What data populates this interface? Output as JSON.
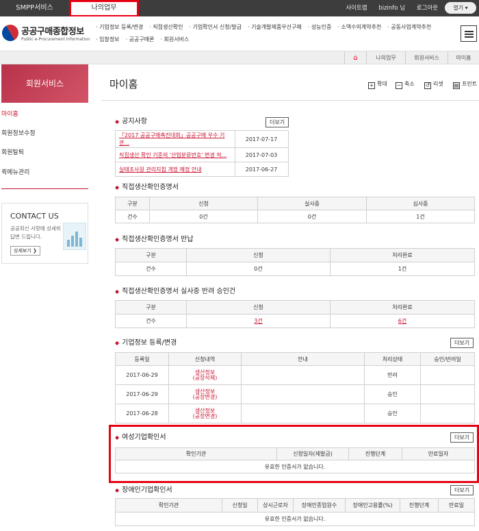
{
  "topbar": {
    "tabs": [
      "SMPP서비스",
      "나의업무"
    ],
    "links": [
      "사이트맵",
      "bizinfo 님",
      "로그아웃"
    ],
    "fold_label": "열기 ▾"
  },
  "header": {
    "logo_title": "공공구매종합정보",
    "logo_sub": "Public e-Procurement Information",
    "menu": [
      "기업정보 등록/변경",
      "직접생산확인",
      "기업확인서 신청/발급",
      "기술개발제품우선구매",
      "성능인증",
      "소액수의계약추천",
      "공동사업계약추천",
      "입찰정보",
      "공공구매론",
      "회원서비스"
    ]
  },
  "breadcrumb": {
    "home_icon": "home-icon",
    "items": [
      "나의업무",
      "회원서비스",
      "마이홈"
    ]
  },
  "sidebar": {
    "title": "회원서비스",
    "items": [
      "마이홈",
      "회원정보수정",
      "회원탈퇴",
      "퀵메뉴관리"
    ],
    "contact": {
      "title": "CONTACT US",
      "text1": "공공회신 사항에 상세히",
      "text2": "답변 드립니다.",
      "button": "상세보기 ❯"
    }
  },
  "main": {
    "page_title": "마이홈",
    "tools": [
      "확대",
      "축소",
      "리셋",
      "프린트"
    ],
    "notice": {
      "title": "공지사항",
      "more": "더보기",
      "rows": [
        {
          "title": "「2017 공공구매촉진대회」공공구매 우수 기관...",
          "date": "2017-07-17"
        },
        {
          "title": "직접생산 확인 기준의 '산업분류번호' 변경 적...",
          "date": "2017-07-03"
        },
        {
          "title": "실태조사원 관리지침 개정 예정 안내",
          "date": "2017-06-27"
        }
      ]
    },
    "cert": {
      "title": "직접생산확인증명서",
      "headers": [
        "구분",
        "신청",
        "실사중",
        "심사중"
      ],
      "row": [
        "건수",
        "0건",
        "0건",
        "1건"
      ]
    },
    "cert_return": {
      "title": "직접생산확인증명서 반납",
      "headers": [
        "구분",
        "신청",
        "처리완료"
      ],
      "row": [
        "건수",
        "0건",
        "1건"
      ]
    },
    "cert_reject": {
      "title": "직접생산확인증명서 실사중 반려 승인건",
      "headers": [
        "구분",
        "신청",
        "처리완료"
      ],
      "row": [
        "건수",
        "3건",
        "6건"
      ]
    },
    "company": {
      "title": "기업정보 등록/변경",
      "more": "더보기",
      "headers": [
        "등록일",
        "신청내역",
        "안내",
        "처리상태",
        "승인/반려일"
      ],
      "rows": [
        {
          "date": "2017-06-29",
          "item1": "생산정보",
          "item2": "(공장삭제)",
          "guide": "",
          "status": "반려",
          "done": ""
        },
        {
          "date": "2017-06-29",
          "item1": "생산정보",
          "item2": "(공장변경)",
          "guide": "",
          "status": "승인",
          "done": ""
        },
        {
          "date": "2017-06-28",
          "item1": "생산정보",
          "item2": "(공장변경)",
          "guide": "",
          "status": "승인",
          "done": ""
        }
      ]
    },
    "women": {
      "title": "여성기업확인서",
      "more": "더보기",
      "headers": [
        "확인기관",
        "신청일자(제발급)",
        "진행단계",
        "만료일자"
      ],
      "empty": "유효한 인증서가 없습니다."
    },
    "disabled": {
      "title": "장애인기업확인서",
      "more": "더보기",
      "headers": [
        "확인기관",
        "신청일",
        "상시근로자",
        "장애인종업원수",
        "장애인고용률(%)",
        "진행단계",
        "만료일"
      ],
      "empty": "유효한 인증서가 없습니다."
    }
  },
  "colors": {
    "accent": "#c8102e",
    "highlight": "#e60012",
    "topbar": "#3d3d3d"
  }
}
